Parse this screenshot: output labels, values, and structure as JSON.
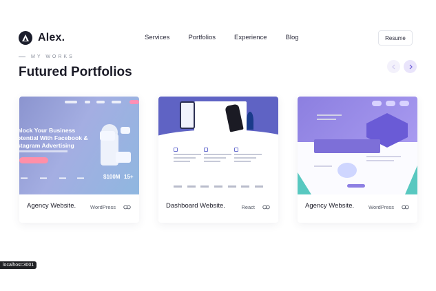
{
  "brand": {
    "name": "Alex."
  },
  "nav": {
    "items": [
      {
        "label": "Services"
      },
      {
        "label": "Portfolios"
      },
      {
        "label": "Experience"
      },
      {
        "label": "Blog"
      }
    ],
    "resume_label": "Resume"
  },
  "section": {
    "eyebrow": "MY WORKS",
    "title": "Futured Portfolios"
  },
  "cards": [
    {
      "title": "Agency Website.",
      "tag": "WordPress",
      "thumb": {
        "hero": [
          "nlock Your Business",
          "otential With Facebook &",
          "stagram Advertising"
        ],
        "stats": [
          "$100M",
          "15+"
        ]
      }
    },
    {
      "title": "Dashboard Website.",
      "tag": "React"
    },
    {
      "title": "Agency Website.",
      "tag": "WordPress"
    }
  ],
  "status_bar": {
    "url": "localhost:3001"
  },
  "colors": {
    "accent_purple": "#e9e4fb",
    "text_dark": "#1c1c28",
    "thumb_blue": "#8b94cf",
    "thumb_indigo": "#5f63c4",
    "thumb_violet": "#8c7fe0",
    "teal": "#58c8c0"
  },
  "icons": {
    "logo": "triangle-logo-icon",
    "prev": "chevron-left-icon",
    "next": "chevron-right-icon",
    "link": "link-icon"
  }
}
